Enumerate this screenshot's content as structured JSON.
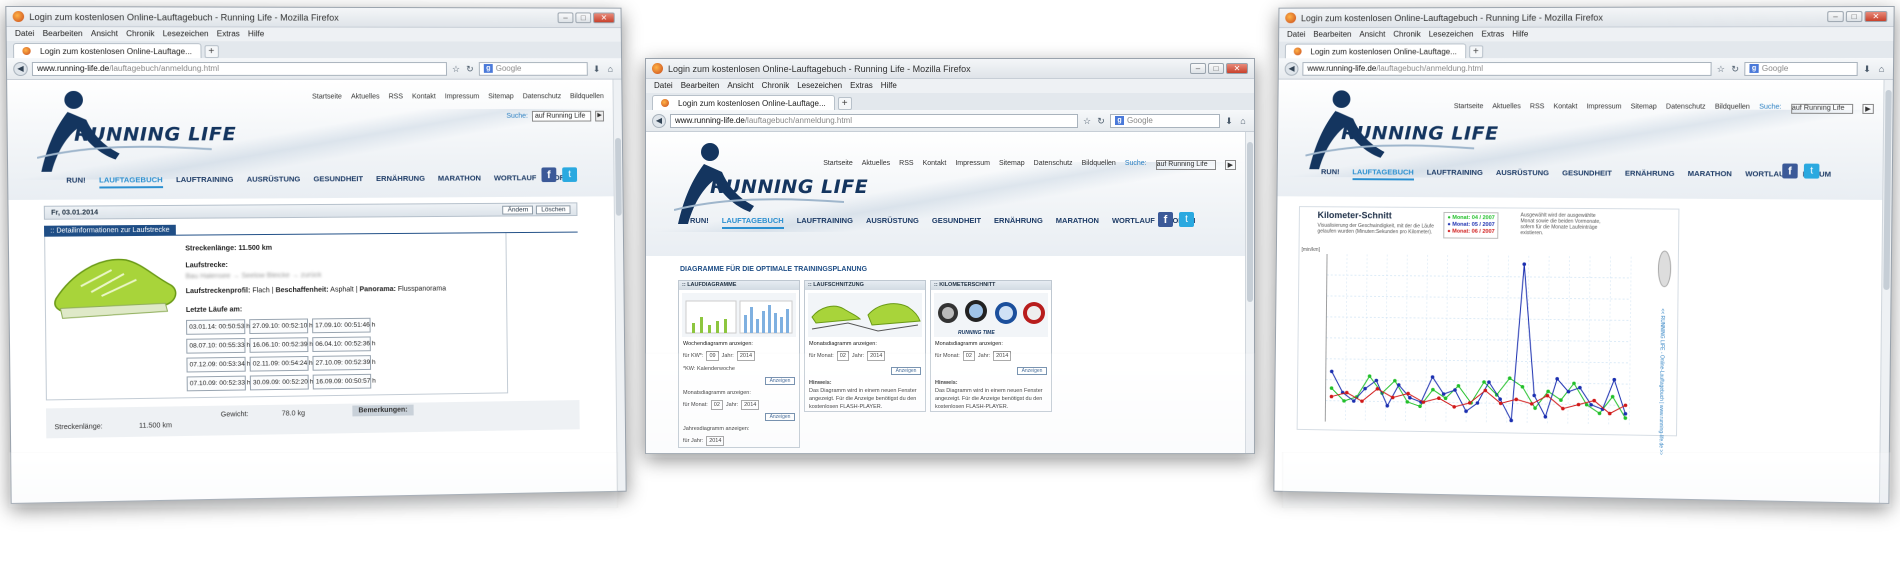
{
  "windows": {
    "left": {
      "title": "Login zum kostenlosen Online-Lauftagebuch - Running Life - Mozilla Firefox",
      "tab_label": "Login zum kostenlosen Online-Lauftage...",
      "url_domain": "www.running-life.de",
      "url_path": "/lauftagebuch/anmeldung.html"
    },
    "mid": {
      "title": "Login zum kostenlosen Online-Lauftagebuch - Running Life - Mozilla Firefox",
      "tab_label": "Login zum kostenlosen Online-Lauftage...",
      "url_domain": "www.running-life.de",
      "url_path": "/lauftagebuch/anmeldung.html"
    },
    "right": {
      "title": "Login zum kostenlosen Online-Lauftagebuch - Running Life - Mozilla Firefox",
      "tab_label": "Login zum kostenlosen Online-Lauftage...",
      "url_domain": "www.running-life.de",
      "url_path": "/lauftagebuch/anmeldung.html"
    }
  },
  "browser": {
    "menu": [
      "Datei",
      "Bearbeiten",
      "Ansicht",
      "Chronik",
      "Lesezeichen",
      "Extras",
      "Hilfe"
    ],
    "search_placeholder": "Google",
    "tab_new": "+"
  },
  "site": {
    "logo": "RUNNING LIFE",
    "topnav": [
      "Startseite",
      "Aktuelles",
      "RSS",
      "Kontakt",
      "Impressum",
      "Sitemap",
      "Datenschutz",
      "Bildquellen"
    ],
    "search_label": "Suche:",
    "search_value": "auf Running Life",
    "mainnav": [
      "RUN!",
      "LAUFTAGEBUCH",
      "LAUFTRAINING",
      "AUSRÜSTUNG",
      "GESUNDHEIT",
      "ERNÄHRUNG",
      "MARATHON",
      "WORTLAUF",
      "FORUM"
    ]
  },
  "left_page": {
    "date": "Fr, 03.01.2014",
    "btn_edit": "Ändern",
    "btn_delete": "Löschen",
    "detail_title": ":: Detailinformationen zur Laufstrecke",
    "length_label": "Streckenlänge:",
    "length_value": "11.500 km",
    "route_label": "Laufstrecke:",
    "route_value": "Bau Halensee → Seelow Bleicke → zurück",
    "profile_line": "Laufstreckenprofil: Flach | Beschaffenheit: Asphalt | Panorama: Flusspanorama",
    "profile_label1": "Laufstreckenprofil:",
    "profile_value1": "Flach",
    "profile_label2": "Beschaffenheit:",
    "profile_value2": "Asphalt",
    "profile_label3": "Panorama:",
    "profile_value3": "Flusspanorama",
    "last_runs_label": "Letzte Läufe am:",
    "runs": [
      "03.01.14: 00:50:53 h",
      "27.09.10: 00:52:10 h",
      "17.09.10: 00:51:46 h",
      "08.07.10: 00:55:33 h",
      "16.06.10: 00:52:39 h",
      "06.04.10: 00:52:36 h",
      "07.12.09: 00:53:34 h",
      "02.11.09: 00:54:24 h",
      "27.10.09: 00:52:39 h",
      "07.10.09: 00:52:33 h",
      "30.09.09: 00:52:20 h",
      "16.09.09: 00:50:57 h"
    ],
    "bottom_length_label": "Streckenlänge:",
    "bottom_length_value": "11.500 km",
    "weight_label": "Gewicht:",
    "weight_value": "78.0 kg",
    "remarks_label": "Bemerkungen:"
  },
  "mid_page": {
    "section_title": "DIAGRAMME FÜR DIE OPTIMALE TRAININGSPLANUNG",
    "panels": [
      {
        "title": ":: LAUFDIAGRAMME",
        "week_label": "Wochendiagramm anzeigen:",
        "kw_label": "für KW*:",
        "kw_value": "09",
        "year_label": "Jahr:",
        "year_value": "2014",
        "footnote": "*KW: Kalenderwoche",
        "month_label": "Monatsdiagramm anzeigen:",
        "month_for": "für Monat:",
        "month_value": "02",
        "year2_value": "2014",
        "yearly_label": "Jahresdiagramm anzeigen:",
        "yearly_for": "für Jahr:",
        "yearly_value": "2014",
        "show": "Anzeigen"
      },
      {
        "title": ":: LAUFSCHNITZUNG",
        "month_label": "Monatsdiagramm anzeigen:",
        "month_for": "für Monat:",
        "month_value": "02",
        "year_label": "Jahr:",
        "year_value": "2014",
        "note_title": "Hinweis:",
        "note": "Das Diagramm wird in einem neuen Fenster angezeigt. Für die Anzeige benötigst du den kostenlosen FLASH-PLAYER.",
        "show": "Anzeigen"
      },
      {
        "title": ":: KILOMETERSCHNITT",
        "month_label": "Monatsdiagramm anzeigen:",
        "month_for": "für Monat:",
        "month_value": "02",
        "year_label": "Jahr:",
        "year_value": "2014",
        "note_title": "Hinweis:",
        "note": "Das Diagramm wird in einem neuen Fenster angezeigt. Für die Anzeige benötigst du den kostenlosen FLASH-PLAYER.",
        "show": "Anzeigen",
        "watch_brand": "RUNNING TIME"
      }
    ]
  },
  "right_page": {
    "chart_title": "Kilometer-Schnitt",
    "chart_sub": "Visualisierung der Geschwindigkeit, mit der die Läufe gelaufen wurden (Minuten:Sekunden pro Kilometer).",
    "legend": [
      "Monat: 04 / 2007",
      "Monat: 05 / 2007",
      "Monat: 06 / 2007"
    ],
    "legend_note": "Ausgewählt wird der ausgewählte Monat sowie die beiden Vormonate, sofern für die Monate Laufeinträge existieren.",
    "y_axis_label": "[min/km]",
    "side_text": "<< RUNNING LIFE - Online-Lauftagebuch | www.running-life.de >>",
    "colors": {
      "green": "#22c02a",
      "blue": "#1b2fb0",
      "red": "#d01818"
    }
  },
  "chart_data": {
    "type": "line",
    "title": "Kilometer-Schnitt",
    "ylabel": "[min/km]",
    "ylim": [
      4.5,
      8.5
    ],
    "series": [
      {
        "name": "Monat: 04 / 2007",
        "color": "#22c02a",
        "values": [
          5.3,
          5.0,
          5.1,
          5.6,
          5.2,
          5.5,
          5.0,
          4.9,
          5.3,
          5.1,
          5.4,
          5.0,
          5.5,
          5.2,
          5.6,
          5.4,
          4.9,
          5.3,
          5.1,
          5.5,
          5.0,
          4.8,
          5.2,
          4.7
        ]
      },
      {
        "name": "Monat: 05 / 2007",
        "color": "#1b2fb0",
        "values": [
          5.7,
          5.2,
          5.0,
          5.3,
          5.5,
          4.9,
          5.4,
          5.1,
          5.0,
          5.6,
          5.2,
          5.3,
          4.8,
          5.0,
          5.5,
          5.1,
          4.6,
          8.3,
          5.2,
          4.7,
          5.6,
          5.3,
          5.4,
          5.0,
          4.9,
          5.6,
          4.8
        ]
      },
      {
        "name": "Monat: 06 / 2007",
        "color": "#d01818",
        "values": [
          5.1,
          5.2,
          5.0,
          5.3,
          5.1,
          5.2,
          5.0,
          5.1,
          4.9,
          5.0,
          5.3,
          5.0,
          5.1,
          5.0,
          5.2,
          4.9,
          5.0,
          5.1,
          4.8,
          5.0
        ]
      }
    ]
  }
}
